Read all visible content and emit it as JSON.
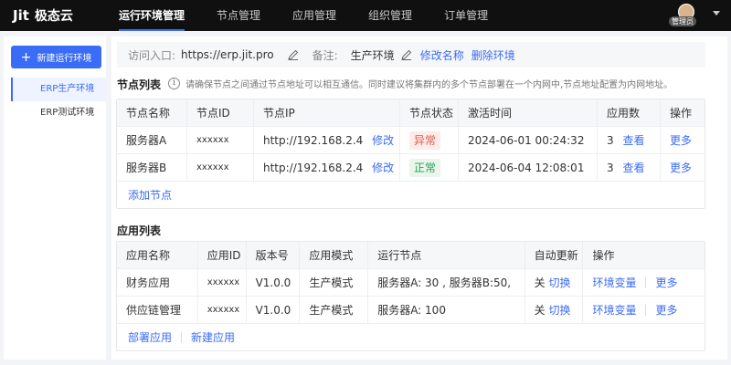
{
  "topbar": {
    "logo_mark": "Jit",
    "logo_text": "极态云",
    "nav": [
      "运行环境管理",
      "节点管理",
      "应用管理",
      "组织管理",
      "订单管理"
    ],
    "avatar_badge": "管理员"
  },
  "sidebar": {
    "new_env_label": "新建运行环境",
    "items": [
      "ERP生产环境",
      "ERP测试环境"
    ]
  },
  "access": {
    "entry_label": "访问入口:",
    "entry_url": "https://erp.jit.pro",
    "note_label": "备注:",
    "note_value": "生产环境",
    "rename": "修改名称",
    "delete": "删除环境"
  },
  "nodes": {
    "title": "节点列表",
    "hint": "请确保节点之间通过节点地址可以相互通信。同时建议将集群内的多个节点部署在一个内网中,节点地址配置为内网地址。",
    "headers": [
      "节点名称",
      "节点ID",
      "节点IP",
      "节点状态",
      "激活时间",
      "应用数",
      "操作"
    ],
    "rows": [
      {
        "name": "服务器A",
        "id": "xxxxxx",
        "ip": "http://192.168.2.4",
        "edit": "修改",
        "status": "异常",
        "time": "2024-06-01 00:24:32",
        "apps": "3",
        "view": "查看",
        "more": "更多"
      },
      {
        "name": "服务器B",
        "id": "xxxxxx",
        "ip": "http://192.168.2.4",
        "edit": "修改",
        "status": "正常",
        "time": "2024-06-04 12:08:01",
        "apps": "3",
        "view": "查看",
        "more": "更多"
      }
    ],
    "add": "添加节点"
  },
  "apps": {
    "title": "应用列表",
    "headers": [
      "应用名称",
      "应用ID",
      "版本号",
      "应用模式",
      "运行节点",
      "自动更新",
      "操作"
    ],
    "rows": [
      {
        "name": "财务应用",
        "id": "xxxxxx",
        "version": "V1.0.0",
        "mode": "生产模式",
        "nodes": "服务器A:  30 , 服务器B:50,",
        "auto": "关",
        "toggle": "切换",
        "env": "环境变量",
        "more": "更多"
      },
      {
        "name": "供应链管理",
        "id": "xxxxxx",
        "version": "V1.0.0",
        "mode": "生产模式",
        "nodes": "服务器A:  100",
        "auto": "关",
        "toggle": "切换",
        "env": "环境变量",
        "more": "更多"
      }
    ],
    "deploy": "部署应用",
    "new": "新建应用"
  },
  "colors": {
    "accent": "#3b6cf5",
    "error": "#e05a4f",
    "ok": "#2f9e57"
  }
}
